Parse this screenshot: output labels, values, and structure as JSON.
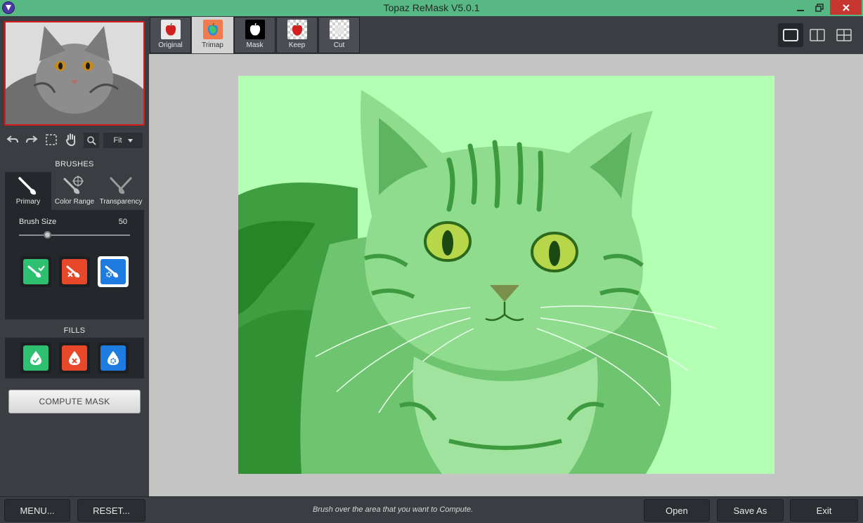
{
  "window": {
    "title": "Topaz ReMask V5.0.1"
  },
  "toolbar": {
    "zoom_select": "Fit"
  },
  "brushes": {
    "heading": "BRUSHES",
    "tabs": [
      {
        "label": "Primary"
      },
      {
        "label": "Color Range"
      },
      {
        "label": "Transparency"
      }
    ],
    "size_label": "Brush Size",
    "size_value": "50",
    "size_level": 0.25
  },
  "fills": {
    "heading": "FILLS"
  },
  "compute_button": "COMPUTE MASK",
  "view_tabs": [
    {
      "label": "Original"
    },
    {
      "label": "Trimap"
    },
    {
      "label": "Mask"
    },
    {
      "label": "Keep"
    },
    {
      "label": "Cut"
    }
  ],
  "bottom": {
    "menu": "MENU...",
    "reset": "RESET...",
    "status": "Brush over the area that you want to Compute.",
    "open": "Open",
    "save_as": "Save As",
    "exit": "Exit"
  },
  "colors": {
    "keep": "#2fbf71",
    "cut": "#e8482a",
    "compute": "#1e7be0",
    "titlebar": "#57b883"
  }
}
